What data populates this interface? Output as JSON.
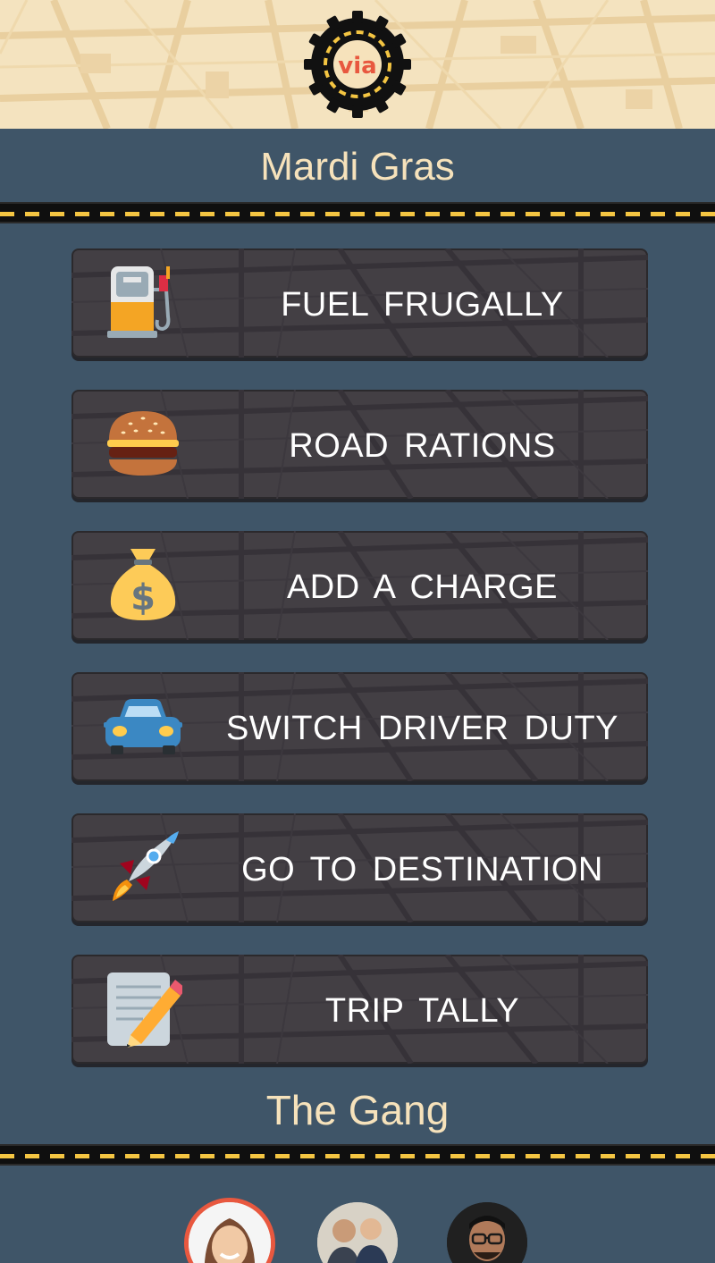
{
  "header": {
    "logo_text": "via",
    "logo_colors": {
      "ring": "#111111",
      "dash": "#f4c542",
      "inner": "#f6e2bb",
      "text": "#e8583f"
    }
  },
  "trip": {
    "title": "Mardi Gras"
  },
  "menu": {
    "items": [
      {
        "label": "FUEL FRUGALLY",
        "icon": "fuel-pump-icon"
      },
      {
        "label": "ROAD RATIONS",
        "icon": "hamburger-icon"
      },
      {
        "label": "ADD A CHARGE",
        "icon": "money-bag-icon"
      },
      {
        "label": "SWITCH DRIVER DUTY",
        "icon": "car-icon"
      },
      {
        "label": "GO TO DESTINATION",
        "icon": "rocket-icon"
      },
      {
        "label": "TRIP TALLY",
        "icon": "memo-pencil-icon"
      }
    ]
  },
  "gang": {
    "title": "The Gang",
    "members": [
      {
        "icon": "avatar-woman-smiling",
        "active": true,
        "ring_color": "#e8583f"
      },
      {
        "icon": "avatar-two-men"
      },
      {
        "icon": "avatar-man-glasses"
      }
    ]
  },
  "colors": {
    "background": "#3f5568",
    "title_text": "#f6e2bb",
    "button_bg": "#433f44",
    "road_dash": "#f4c542"
  }
}
